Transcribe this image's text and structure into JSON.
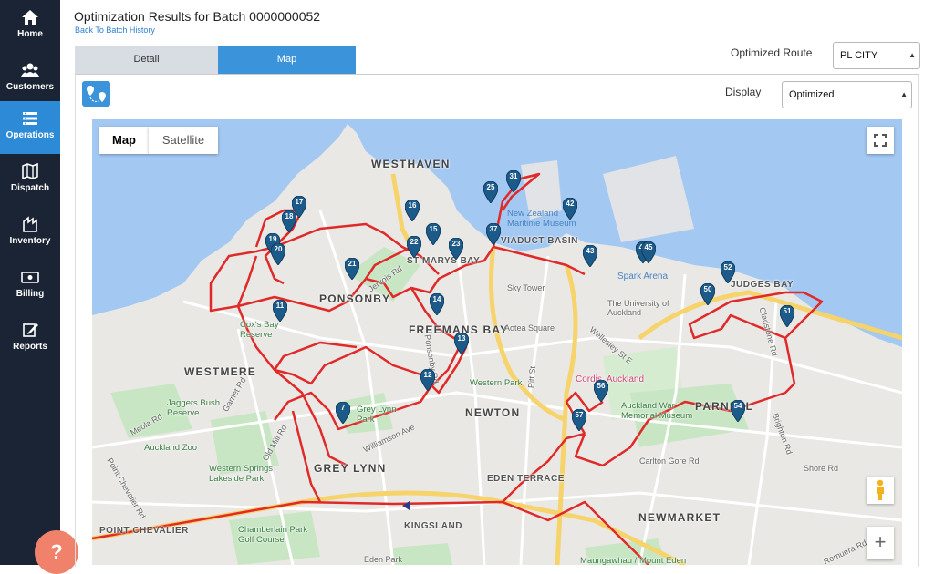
{
  "sidebar": {
    "items": [
      {
        "label": "Home",
        "icon": "home-icon"
      },
      {
        "label": "Customers",
        "icon": "users-icon"
      },
      {
        "label": "Operations",
        "icon": "operations-icon",
        "active": true
      },
      {
        "label": "Dispatch",
        "icon": "map-book-icon"
      },
      {
        "label": "Inventory",
        "icon": "inventory-icon"
      },
      {
        "label": "Billing",
        "icon": "billing-icon"
      },
      {
        "label": "Reports",
        "icon": "reports-icon"
      }
    ],
    "help_label": "?"
  },
  "header": {
    "title": "Optimization Results for Batch 0000000052",
    "back_link": "Back To Batch History"
  },
  "tabs": [
    {
      "label": "Detail",
      "active": false
    },
    {
      "label": "Map",
      "active": true
    }
  ],
  "controls": {
    "route_label": "Optimized Route",
    "route_value": "PL CITY",
    "display_label": "Display",
    "display_value": "Optimized"
  },
  "map": {
    "type_map": "Map",
    "type_satellite": "Satellite",
    "zoom_in": "+",
    "route_color": "#e02a2a",
    "marker_color": "#1c5a8a",
    "places": [
      "WESTHAVEN",
      "PONSONBY",
      "FREEMANS BAY",
      "NEWTON",
      "GREY LYNN",
      "WESTMERE",
      "PARNELL",
      "NEWMARKET",
      "EDEN TERRACE",
      "KINGSLAND",
      "VIADUCT BASIN",
      "JUDGES BAY",
      "POINT CHEVALIER",
      "ST MARYS BAY",
      "New Zealand Maritime Museum",
      "Sky Tower",
      "The University of Auckland",
      "Aotea Square",
      "Western Park",
      "Cordis, Auckland",
      "Auckland War Memorial Museum",
      "Cox's Bay Reserve",
      "Jaggers Bush Reserve",
      "Grey Lynn Park",
      "Auckland Zoo",
      "Western Springs Lakeside Park",
      "Chamberlain Park Golf Course",
      "Eden Park",
      "Spark Arena",
      "Maungawhau / Mount Eden",
      "Wellesley St E",
      "Carlton Gore Rd",
      "Shore Rd",
      "Meola Rd",
      "Old Mill Rd",
      "Point Chevalier Rd",
      "Williamson Ave",
      "Garnet Rd",
      "Jervois Rd",
      "Ponsonby Rd",
      "Pitt St",
      "Gladstone Rd",
      "Brighton Rd",
      "Remuera Rd"
    ],
    "markers": [
      "17",
      "18",
      "19",
      "20",
      "21",
      "11",
      "16",
      "22",
      "15",
      "23",
      "14",
      "13",
      "12",
      "7",
      "25",
      "31",
      "42",
      "37",
      "43",
      "44",
      "45",
      "50",
      "51",
      "56",
      "57",
      "52",
      "54"
    ]
  }
}
